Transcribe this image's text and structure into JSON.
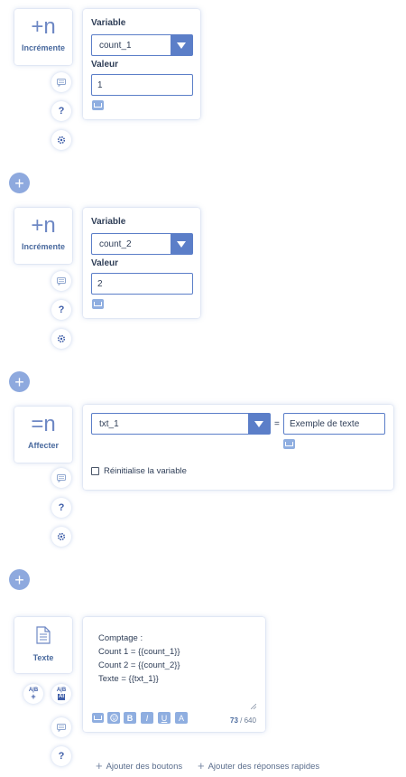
{
  "blocks": [
    {
      "type": "increment",
      "icon_glyph": "+n",
      "label": "Incrémente",
      "variable_label": "Variable",
      "variable_value": "count_1",
      "value_label": "Valeur",
      "value": "1"
    },
    {
      "type": "increment",
      "icon_glyph": "+n",
      "label": "Incrémente",
      "variable_label": "Variable",
      "variable_value": "count_2",
      "value_label": "Valeur",
      "value": "2"
    },
    {
      "type": "assign",
      "icon_glyph": "=n",
      "label": "Affecter",
      "variable_value": "txt_1",
      "equals": "=",
      "value": "Exemple de texte",
      "reset_label": "Réinitialise la variable"
    },
    {
      "type": "text",
      "label": "Texte",
      "content_lines": [
        "Comptage :",
        "Count 1 = {{count_1}}",
        "Count 2 = {{count_2}}",
        "Texte = {{txt_1}}"
      ],
      "char_count": "73",
      "char_limit": "/ 640",
      "format_buttons": [
        "B",
        "I",
        "U",
        "A"
      ],
      "add_buttons_label": "Ajouter des boutons",
      "add_quick_replies_label": "Ajouter des réponses rapides"
    }
  ],
  "side_actions": {
    "comment_icon": "comment-icon",
    "help_label": "?",
    "settings_icon": "gear-icon"
  },
  "add_step_icon": "plus-icon",
  "ab_labels": [
    "A|B",
    "A|B"
  ],
  "colors": {
    "accent": "#5b7ec8",
    "accent_light": "#8ea9de",
    "text": "#2f3e57"
  }
}
